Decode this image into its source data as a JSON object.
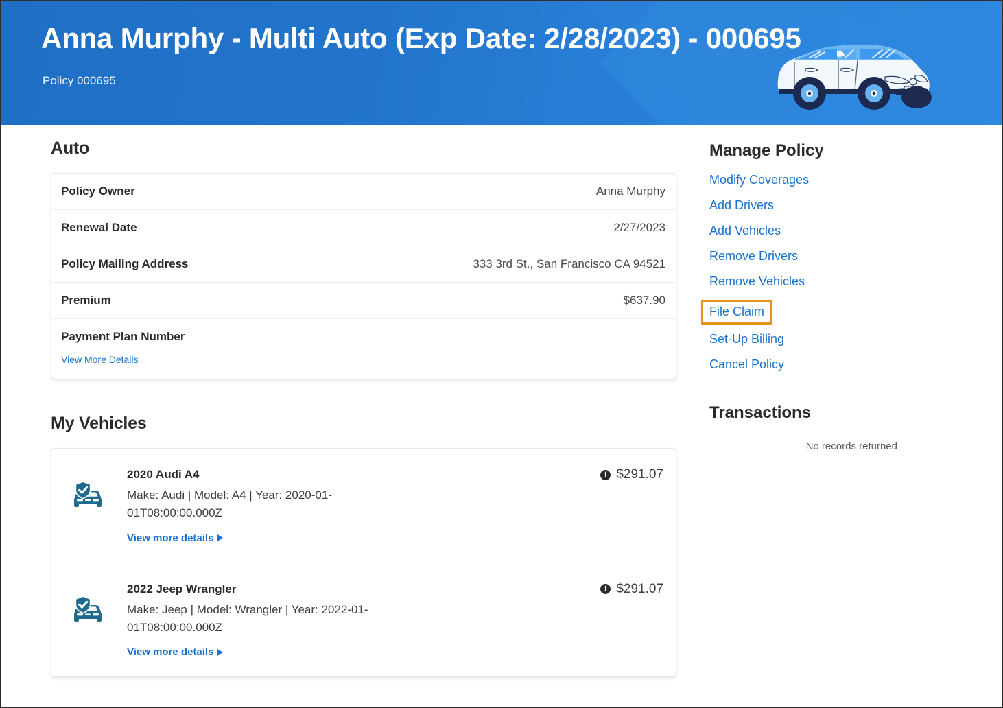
{
  "header": {
    "title": "Anna Murphy - Multi Auto (Exp Date: 2/28/2023) - 000695",
    "subtitle": "Policy 000695",
    "illustration": "car-illustration",
    "background_color": "#2274cb"
  },
  "main": {
    "auto_section": {
      "title": "Auto",
      "rows": [
        {
          "label": "Policy Owner",
          "value": "Anna Murphy"
        },
        {
          "label": "Renewal Date",
          "value": "2/27/2023"
        },
        {
          "label": "Policy Mailing Address",
          "value": "333 3rd St., San Francisco CA 94521"
        },
        {
          "label": "Premium",
          "value": "$637.90"
        },
        {
          "label": "Payment Plan Number",
          "value": ""
        }
      ],
      "more_link": "View More Details"
    },
    "vehicles_section": {
      "title": "My Vehicles",
      "link_label": "View more details",
      "vehicles": [
        {
          "name": "2020 Audi A4",
          "meta": "Make: Audi | Model: A4 | Year: 2020-01-01T08:00:00.000Z",
          "price": "$291.07",
          "icon": "car-shield-icon"
        },
        {
          "name": "2022 Jeep Wrangler",
          "meta": "Make: Jeep | Model: Wrangler | Year: 2022-01-01T08:00:00.000Z",
          "price": "$291.07",
          "icon": "car-shield-icon"
        }
      ]
    }
  },
  "sidebar": {
    "manage_policy": {
      "title": "Manage Policy",
      "items": [
        {
          "label": "Modify Coverages",
          "highlighted": false
        },
        {
          "label": "Add Drivers",
          "highlighted": false
        },
        {
          "label": "Add Vehicles",
          "highlighted": false
        },
        {
          "label": "Remove Drivers",
          "highlighted": false
        },
        {
          "label": "Remove Vehicles",
          "highlighted": false
        },
        {
          "label": "File Claim",
          "highlighted": true
        },
        {
          "label": "Set-Up Billing",
          "highlighted": false
        },
        {
          "label": "Cancel Policy",
          "highlighted": false
        }
      ],
      "highlight_color": "#e6921e"
    },
    "transactions": {
      "title": "Transactions",
      "empty_message": "No records returned"
    }
  },
  "colors": {
    "link": "#1b72cb",
    "header_blue": "#2274cb",
    "icon_teal": "#1f6b8f",
    "highlight_orange": "#e6921e"
  }
}
